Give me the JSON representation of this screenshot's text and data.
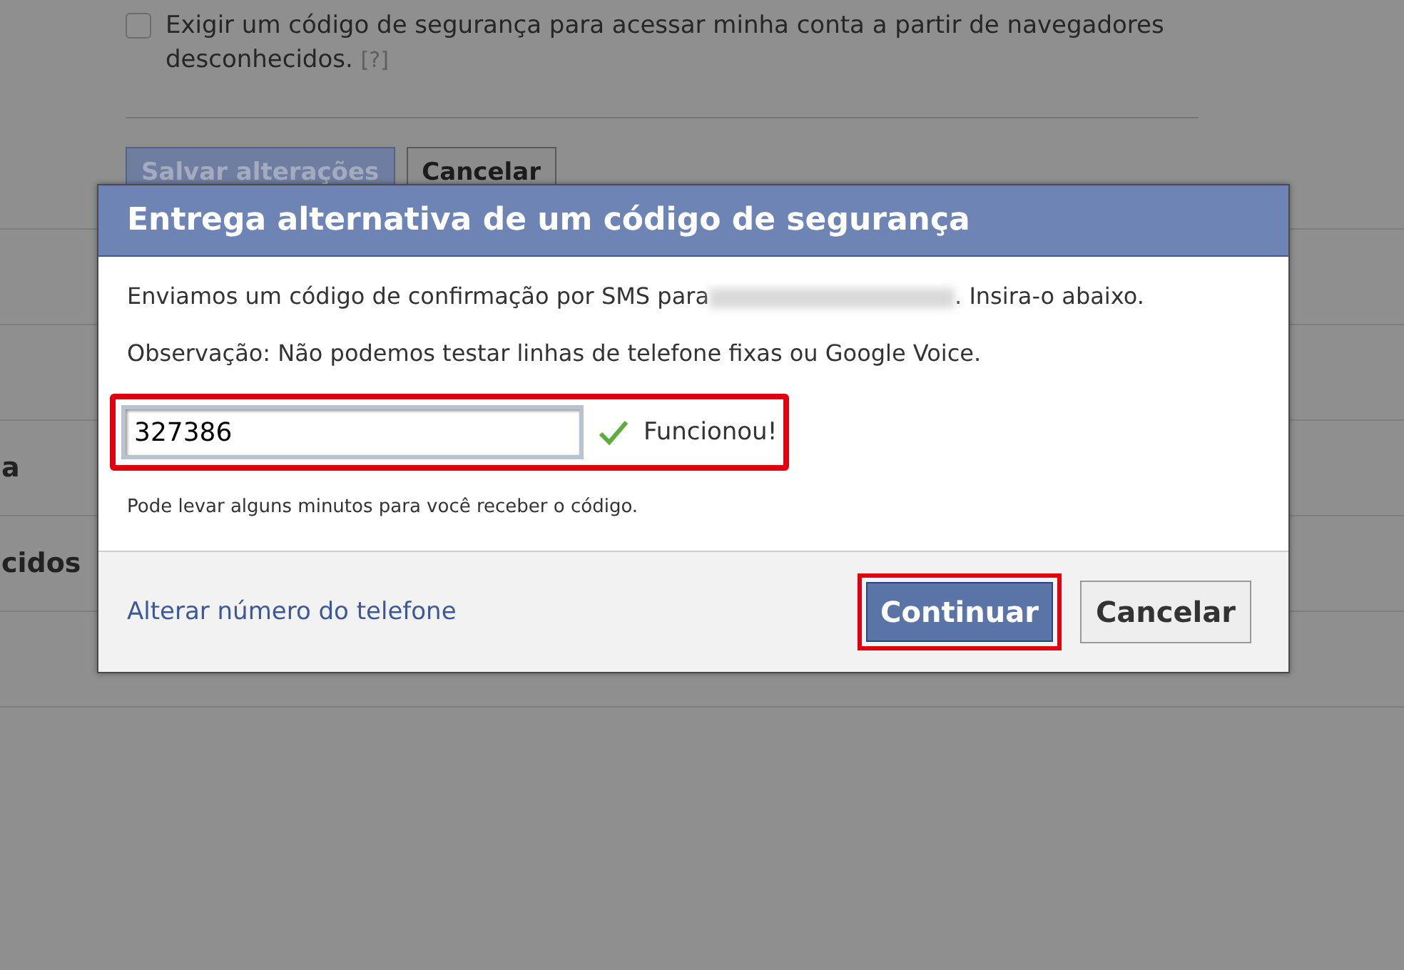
{
  "background": {
    "checkbox": {
      "label": "Exigir um código de segurança para acessar minha conta a partir de navegadores desconhecidos.",
      "help": "[?]",
      "checked": false
    },
    "buttons": [
      {
        "label": "Salvar alterações",
        "kind": "primary",
        "disabled": true
      },
      {
        "label": "Cancelar",
        "kind": "secondary",
        "disabled": false
      }
    ],
    "rows": [
      "",
      "",
      "a",
      "cidos",
      "",
      ""
    ]
  },
  "dialog": {
    "title": "Entrega alternativa de um código de segurança",
    "message_start": "Enviamos um código de confirmação por SMS para",
    "message_end": ". Insira-o abaixo.",
    "note": "Observação: Não podemos testar linhas de telefone fixas ou Google Voice.",
    "code": {
      "value": "327386",
      "highlighted": true
    },
    "status": "Funcionou!",
    "hint": "Pode levar alguns minutos para você receber o código.",
    "link": "Alterar número do telefone",
    "buttons": [
      {
        "label": "Continuar",
        "kind": "primary",
        "highlighted": true
      },
      {
        "label": "Cancelar",
        "kind": "secondary",
        "highlighted": false
      }
    ]
  }
}
